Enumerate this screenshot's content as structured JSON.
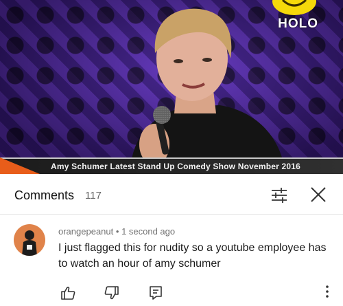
{
  "video": {
    "channel_logo_text": "HOLO",
    "banner_title": "Amy Schumer Latest Stand Up Comedy Show November 2016"
  },
  "comments": {
    "title": "Comments",
    "count": "117"
  },
  "comment": {
    "author": "orangepeanut",
    "separator": "•",
    "time": "1 second ago",
    "text": "I just flagged this for nudity so a youtube employee has to watch an hour of amy schumer"
  },
  "icons": {
    "filter": "sort-filter-icon",
    "close": "close-icon",
    "like": "thumbs-up-icon",
    "dislike": "thumbs-down-icon",
    "reply": "reply-icon",
    "more": "more-vertical-icon"
  },
  "colors": {
    "banner_accent": "#e85d1a",
    "avatar_bg": "#e0834a",
    "logo_yellow": "#f5d90a"
  }
}
